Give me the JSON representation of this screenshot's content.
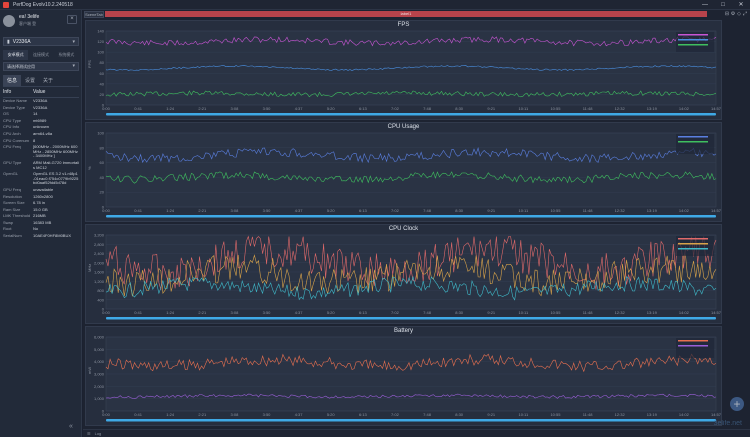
{
  "window": {
    "title": "PerfDog Evolv10.2.240518",
    "controls": [
      "—",
      "□",
      "✕"
    ]
  },
  "sidebar": {
    "user_name": "ea! 3elife",
    "user_sub": "客户端 登",
    "device": "V2336A",
    "mode_tabs": [
      "安卓模式",
      "连接模式",
      "系统模式"
    ],
    "app_placeholder": "请选择测试应用",
    "info_tabs": [
      "信息",
      "设置",
      "关于"
    ],
    "info_header": {
      "key": "Info",
      "value": "Value"
    },
    "info_rows": [
      {
        "k": "Device Name",
        "v": "V2336A"
      },
      {
        "k": "Device Type",
        "v": "V2336A"
      },
      {
        "k": "OS",
        "v": "14"
      },
      {
        "k": "CPU Type",
        "v": "mt6989"
      },
      {
        "k": "CPU Info",
        "v": "unknown"
      },
      {
        "k": "CPU Arch",
        "v": "arm64-v8a"
      },
      {
        "k": "CPU Corenum",
        "v": "8"
      },
      {
        "k": "CPU Freq",
        "v": "[600MHz - 2000MHz 600MHz - 2850MHz 600MHz - 3400MHz ]"
      },
      {
        "k": "GPU Type",
        "v": "ARM Mali-G720 Immortalis MC12"
      },
      {
        "k": "OpenGL",
        "v": "OpenGL ES 3.2 v1.r48p1-01eac0.f754c0779b9225bd0aaf52fdd5d78d"
      },
      {
        "k": "GPU Freq",
        "v": "unavailable"
      },
      {
        "k": "Resolution",
        "v": "1260x2800"
      },
      {
        "k": "Screen Size",
        "v": "6.78 in"
      },
      {
        "k": "Ram Size",
        "v": "15.0 GB"
      },
      {
        "k": "LMK Threshold",
        "v": "216MB"
      },
      {
        "k": "Swap",
        "v": "16383 MB"
      },
      {
        "k": "Root",
        "v": "No"
      },
      {
        "k": "SerialNum",
        "v": "10AE4F0HF8M0BUX"
      }
    ]
  },
  "main": {
    "scene_tab": "SceneTab",
    "label_bar": "label1",
    "bottom_text": "Log",
    "watermark": "3elife.net"
  },
  "charts": [
    {
      "title": "FPS",
      "ylabel": "FPS",
      "yticks": [
        "140",
        "120",
        "100",
        "80",
        "60",
        "40",
        "20",
        "0"
      ]
    },
    {
      "title": "CPU Usage",
      "ylabel": "%",
      "yticks": [
        "100",
        "80",
        "60",
        "40",
        "20",
        "0"
      ]
    },
    {
      "title": "CPU Clock",
      "ylabel": "MHz",
      "yticks": [
        "3,200",
        "2,800",
        "2,400",
        "2,000",
        "1,600",
        "1,200",
        "800",
        "400",
        "0"
      ]
    },
    {
      "title": "Battery",
      "ylabel": "mW",
      "yticks": [
        "6,000",
        "5,000",
        "4,000",
        "3,000",
        "2,000",
        "1,000",
        "0"
      ]
    }
  ],
  "x_ticks": [
    "0:00",
    "0:41",
    "1:24",
    "2:21",
    "3:08",
    "3:50",
    "4:37",
    "5:20",
    "6:13",
    "7:02",
    "7:48",
    "8:30",
    "9:21",
    "10:11",
    "10:55",
    "11:48",
    "12:32",
    "13:19",
    "14:02",
    "14:57"
  ],
  "colors": {
    "fps": "#c855d4",
    "jank": "#3fbf5f",
    "fps_low": "#4a8fe0",
    "cpu_total": "#5a7fe0",
    "cpu_app": "#3fbf5f",
    "clk_a": "#e06a6a",
    "clk_b": "#3fb8c8",
    "clk_c": "#d8a34a",
    "bat_power": "#e87050",
    "bat_low": "#9a5fd8"
  }
}
